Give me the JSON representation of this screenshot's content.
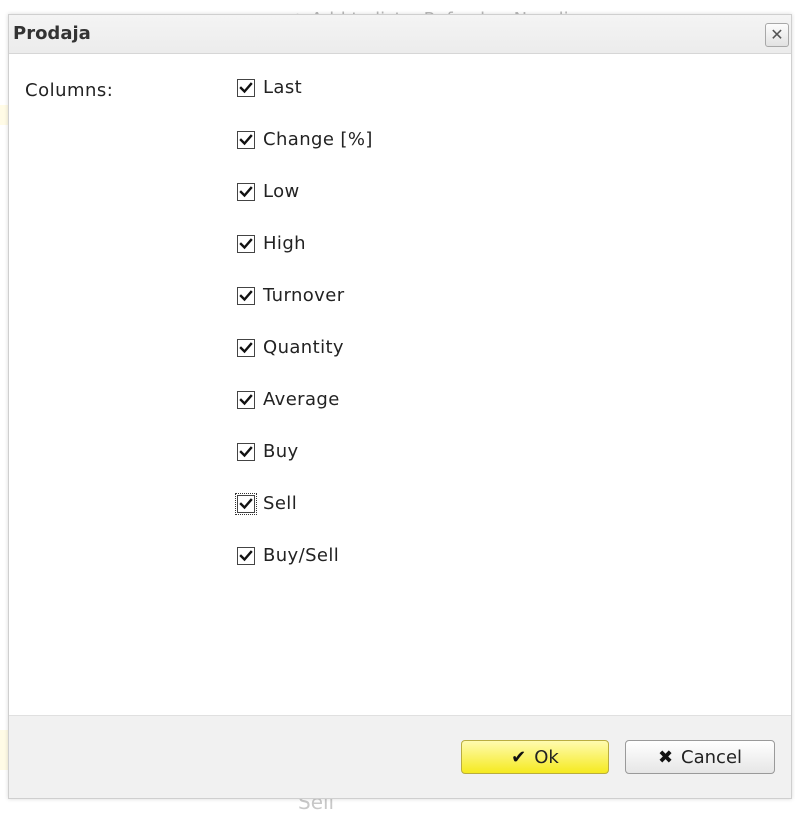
{
  "background": {
    "toolbar": {
      "add_to_list": "+ Add to list",
      "refresh": "Refresh",
      "new_list": "New lis"
    },
    "bottom_text": "Sell"
  },
  "dialog": {
    "title": "Prodaja",
    "close_glyph": "✕",
    "columns_label": "Columns:",
    "columns": [
      {
        "label": "Last",
        "checked": true
      },
      {
        "label": "Change [%]",
        "checked": true
      },
      {
        "label": "Low",
        "checked": true
      },
      {
        "label": "High",
        "checked": true
      },
      {
        "label": "Turnover",
        "checked": true
      },
      {
        "label": "Quantity",
        "checked": true
      },
      {
        "label": "Average",
        "checked": true
      },
      {
        "label": "Buy",
        "checked": true
      },
      {
        "label": "Sell",
        "checked": true,
        "focused": true
      },
      {
        "label": "Buy/Sell",
        "checked": true
      }
    ],
    "buttons": {
      "ok": {
        "label": "Ok",
        "icon": "check-icon",
        "glyph": "✔"
      },
      "cancel": {
        "label": "Cancel",
        "icon": "x-icon",
        "glyph": "✖"
      }
    }
  },
  "colors": {
    "ok_button": "#f5ea20",
    "header_bg": "#efefef",
    "footer_bg": "#f1f1f1"
  }
}
